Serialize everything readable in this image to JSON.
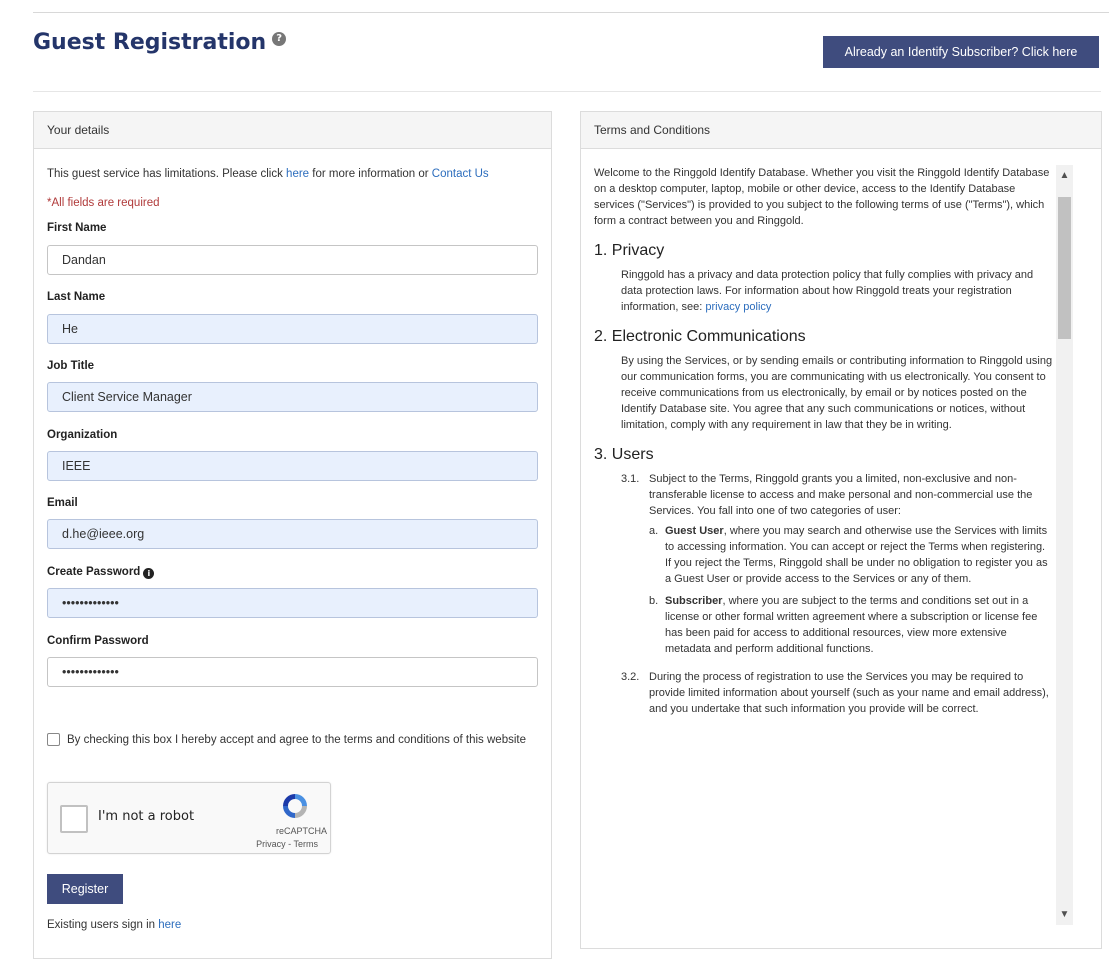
{
  "header": {
    "title": "Guest Registration",
    "help_icon": "?",
    "subscriber_button": "Already an Identify Subscriber? Click here"
  },
  "details": {
    "panel_title": "Your details",
    "info_prefix": "This guest service has limitations. Please click ",
    "info_link": "here",
    "info_middle": " for more information or ",
    "contact_link": "Contact Us",
    "required_note": "*All fields are required",
    "fields": {
      "first_name": {
        "label": "First Name",
        "value": "Dandan"
      },
      "last_name": {
        "label": "Last Name",
        "value": "He"
      },
      "job_title": {
        "label": "Job Title",
        "value": "Client Service Manager"
      },
      "organization": {
        "label": "Organization",
        "value": "IEEE"
      },
      "email": {
        "label": "Email",
        "value": "d.he@ieee.org"
      },
      "create_password": {
        "label": "Create Password",
        "value": "•••••••••••••"
      },
      "confirm_password": {
        "label": "Confirm Password",
        "value": "•••••••••••••"
      }
    },
    "info_icon": "i",
    "terms_checkbox_label": "By checking this box I hereby accept and agree to the terms and conditions of this website",
    "recaptcha": {
      "label": "I'm not a robot",
      "brand": "reCAPTCHA",
      "links": "Privacy - Terms"
    },
    "register_button": "Register",
    "signin_prefix": "Existing users sign in ",
    "signin_link": "here"
  },
  "terms": {
    "panel_title": "Terms and Conditions",
    "intro": "Welcome to the Ringgold Identify Database. Whether you visit the Ringgold Identify Database on a desktop computer, laptop, mobile or other device, access to the Identify Database services (\"Services\") is provided to you subject to the following terms of use (\"Terms\"), which form a contract between you and Ringgold.",
    "s1_title": "1.  Privacy",
    "s1_body": "Ringgold has a privacy and data protection policy that fully complies with privacy and data protection laws. For information about how Ringgold treats your registration information, see: ",
    "s1_link": "privacy policy",
    "s2_title": "2.  Electronic Communications",
    "s2_body": "By using the Services, or by sending emails or contributing information to Ringgold using our communication forms, you are communicating with us electronically. You consent to receive communications from us electronically, by email or by notices posted on the Identify Database site. You agree that any such communications or notices, without limitation, comply with any requirement in law that they be in writing.",
    "s3_title": "3.  Users",
    "s31_num": "3.1.",
    "s31_body": "Subject to the Terms, Ringgold grants you a limited, non-exclusive and non-transferable license to access and make personal and non-commercial use the Services. You fall into one of two categories of user:",
    "a_mark": "a.",
    "a_bold": "Guest User",
    "a_text": ", where you may search and otherwise use the Services with limits to accessing information. You can accept or reject the Terms when registering. If you reject the Terms, Ringgold shall be under no obligation to register you as a Guest User or provide access to the Services or any of them.",
    "b_mark": "b.",
    "b_bold": "Subscriber",
    "b_text": ", where you are subject to the terms and conditions set out in a license or other formal written agreement where a subscription or license fee has been paid for access to additional resources, view more extensive metadata and perform additional functions.",
    "s32_num": "3.2.",
    "s32_body": "During the process of registration to use the Services you may be required to provide limited information about yourself (such as your name and email address), and you undertake that such information you provide will be correct."
  },
  "colors": {
    "title": "#24356a",
    "button": "#3f4c7e",
    "link": "#2c6dbd",
    "required": "#b03a3a",
    "autofill": "#e8f0fd"
  }
}
